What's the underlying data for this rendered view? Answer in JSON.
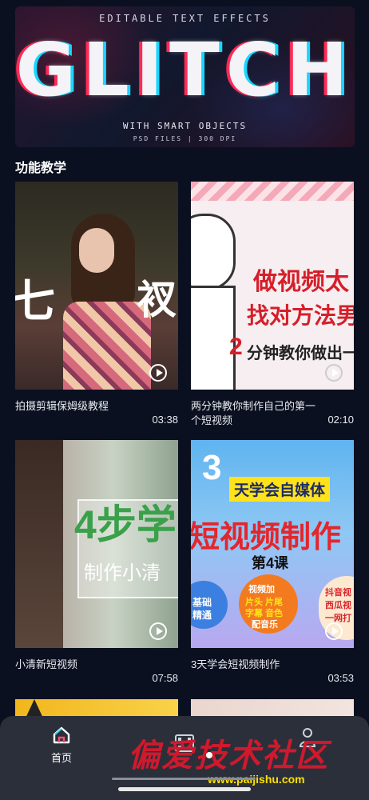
{
  "banner": {
    "top_text": "EDITABLE TEXT EFFECTS",
    "main_text": "GLITCH",
    "sub_text": "WITH SMART OBJECTS",
    "sub_text2": "PSD FILES | 300 DPI"
  },
  "section": {
    "title": "功能教学"
  },
  "cards": [
    {
      "title": "拍摄剪辑保姆级教程",
      "duration": "03:38",
      "overlay": [
        "七",
        "衩"
      ]
    },
    {
      "title": "两分钟教你制作自己的第一个短视频",
      "duration": "02:10",
      "overlay": [
        "做视频太",
        "找对方法男",
        "2",
        "分钟教你做出一"
      ]
    },
    {
      "title": "小清新短视频",
      "duration": "07:58",
      "overlay": [
        "4步学",
        "制作小清"
      ]
    },
    {
      "title": "3天学会短视频制作",
      "duration": "03:53",
      "overlay": [
        "3",
        "天学会自媒体",
        "短视频制作",
        "第4课",
        "视频加",
        "片头 片尾",
        "字幕 音色",
        "配音乐",
        "基础",
        "精通",
        "抖音视",
        "西瓜视",
        "一网打"
      ]
    }
  ],
  "tabbar": {
    "tabs": [
      {
        "label": "首页",
        "icon": "home-icon",
        "active": true
      },
      {
        "label": "",
        "icon": "film-icon",
        "active": false
      },
      {
        "label": "",
        "icon": "user-icon",
        "active": false
      }
    ]
  },
  "watermark": {
    "text": "偏爱技术社区",
    "url": "www.paijishu.com"
  },
  "colors": {
    "background": "#0b1020",
    "tabbar": "#2b2f3a",
    "accent_red": "#d0192d"
  }
}
